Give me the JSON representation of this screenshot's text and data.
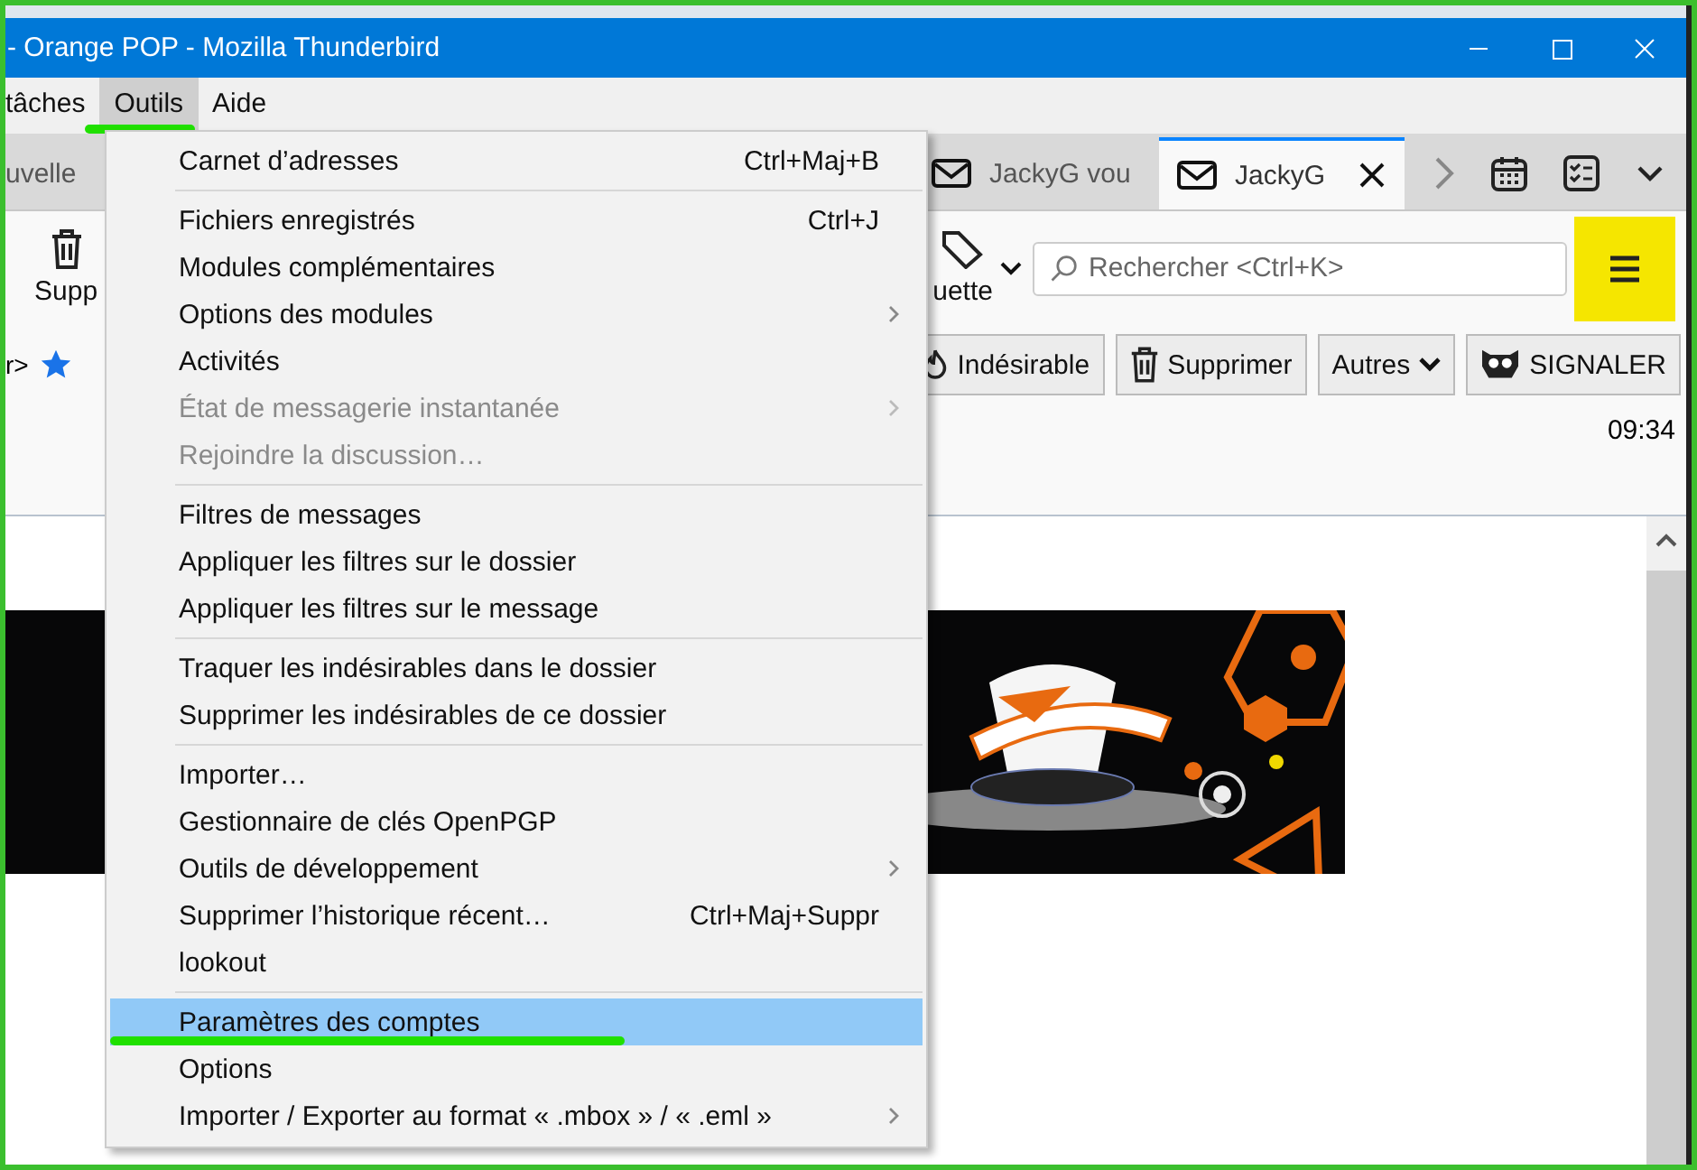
{
  "window": {
    "title": "- Orange POP - Mozilla Thunderbird"
  },
  "menubar": [
    {
      "label": "tâches",
      "selected": false,
      "marked": false
    },
    {
      "label": "Outils",
      "selected": true,
      "marked": true
    },
    {
      "label": "Aide",
      "selected": false,
      "marked": false
    }
  ],
  "tabs": [
    {
      "label": "uvelle",
      "kind": "plain",
      "selected": false
    },
    {
      "label": "JackyG vou",
      "kind": "mail",
      "selected": false
    },
    {
      "label": "JackyG",
      "kind": "mail",
      "selected": true
    }
  ],
  "toolbar": {
    "delete_label": "Supp",
    "tag_label": "uette",
    "search": {
      "placeholder": "Rechercher <Ctrl+K>"
    },
    "app_menu": {
      "highlighted": true
    }
  },
  "header": {
    "sender": "r>",
    "starred": true,
    "buttons": [
      {
        "label": "Indésirable",
        "kind": "junk"
      },
      {
        "label": "Supprimer",
        "kind": "trash"
      },
      {
        "label": "Autres",
        "kind": "more"
      },
      {
        "label": "SIGNALER",
        "kind": "report"
      }
    ],
    "time": "09:34"
  },
  "menu": {
    "items": [
      {
        "kind": "item",
        "label": "Carnet d’adresses",
        "shortcut": "Ctrl+Maj+B",
        "submenu": false,
        "disabled": false,
        "selected": false,
        "marked": false
      },
      {
        "kind": "separator"
      },
      {
        "kind": "item",
        "label": "Fichiers enregistrés",
        "shortcut": "Ctrl+J",
        "submenu": false,
        "disabled": false,
        "selected": false,
        "marked": false
      },
      {
        "kind": "item",
        "label": "Modules complémentaires",
        "submenu": false,
        "disabled": false,
        "selected": false,
        "marked": false
      },
      {
        "kind": "item",
        "label": "Options des modules",
        "submenu": true,
        "disabled": false,
        "selected": false,
        "marked": false
      },
      {
        "kind": "item",
        "label": "Activités",
        "submenu": false,
        "disabled": false,
        "selected": false,
        "marked": false
      },
      {
        "kind": "item",
        "label": "État de messagerie instantanée",
        "submenu": true,
        "disabled": true,
        "selected": false,
        "marked": false
      },
      {
        "kind": "item",
        "label": "Rejoindre la discussion…",
        "submenu": false,
        "disabled": true,
        "selected": false,
        "marked": false
      },
      {
        "kind": "separator"
      },
      {
        "kind": "item",
        "label": "Filtres de messages",
        "submenu": false,
        "disabled": false,
        "selected": false,
        "marked": false
      },
      {
        "kind": "item",
        "label": "Appliquer les filtres sur le dossier",
        "submenu": false,
        "disabled": false,
        "selected": false,
        "marked": false
      },
      {
        "kind": "item",
        "label": "Appliquer les filtres sur le message",
        "submenu": false,
        "disabled": false,
        "selected": false,
        "marked": false
      },
      {
        "kind": "separator"
      },
      {
        "kind": "item",
        "label": "Traquer les indésirables dans le dossier",
        "submenu": false,
        "disabled": false,
        "selected": false,
        "marked": false
      },
      {
        "kind": "item",
        "label": "Supprimer les indésirables de ce dossier",
        "submenu": false,
        "disabled": false,
        "selected": false,
        "marked": false
      },
      {
        "kind": "separator"
      },
      {
        "kind": "item",
        "label": "Importer…",
        "submenu": false,
        "disabled": false,
        "selected": false,
        "marked": false
      },
      {
        "kind": "item",
        "label": "Gestionnaire de clés OpenPGP",
        "submenu": false,
        "disabled": false,
        "selected": false,
        "marked": false
      },
      {
        "kind": "item",
        "label": "Outils de développement",
        "submenu": true,
        "disabled": false,
        "selected": false,
        "marked": false
      },
      {
        "kind": "item",
        "label": "Supprimer l’historique récent…",
        "shortcut": "Ctrl+Maj+Suppr",
        "submenu": false,
        "disabled": false,
        "selected": false,
        "marked": false
      },
      {
        "kind": "item",
        "label": "lookout",
        "submenu": false,
        "disabled": false,
        "selected": false,
        "marked": false
      },
      {
        "kind": "separator"
      },
      {
        "kind": "item",
        "label": "Paramètres des comptes",
        "submenu": false,
        "disabled": false,
        "selected": true,
        "marked": true
      },
      {
        "kind": "item",
        "label": "Options",
        "submenu": false,
        "disabled": false,
        "selected": false,
        "marked": false
      },
      {
        "kind": "item",
        "label": "Importer / Exporter au format « .mbox » / « .eml »",
        "submenu": true,
        "disabled": false,
        "selected": false,
        "marked": false
      }
    ]
  }
}
